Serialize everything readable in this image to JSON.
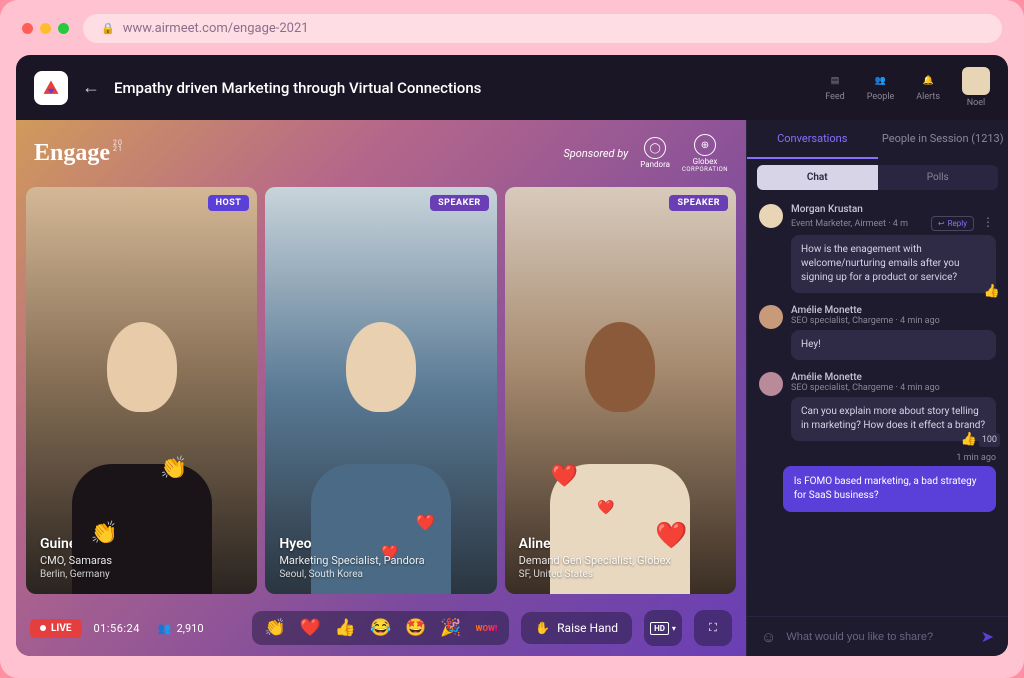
{
  "browser": {
    "url": "www.airmeet.com/engage-2021"
  },
  "header": {
    "title": "Empathy driven Marketing through Virtual Connections",
    "nav": [
      "Feed",
      "People",
      "Alerts"
    ],
    "user": "Noel"
  },
  "stage": {
    "brand": "Engage",
    "brand_year_top": "20",
    "brand_year_bottom": "21",
    "sponsored_by": "Sponsored by",
    "sponsors": [
      "Pandora",
      "Globex"
    ],
    "sponsor2_line2": "CORPORATION",
    "speakers": [
      {
        "role": "HOST",
        "name": "Guinevere Frazier",
        "title": "CMO, Samaras",
        "loc": "Berlin, Germany"
      },
      {
        "role": "SPEAKER",
        "name": "Hyeon Chin-Hae",
        "title": "Marketing Specialist, Pandora",
        "loc": "Seoul, South Korea"
      },
      {
        "role": "SPEAKER",
        "name": "Aline Richard",
        "title": "Demand Gen Specialist, Globex",
        "loc": "SF, United States"
      }
    ],
    "live": "LIVE",
    "time": "01:56:24",
    "viewers": "2,910",
    "raise_hand": "Raise Hand",
    "hd_label": "HD",
    "reactions_wow": "WOW!"
  },
  "sidebar": {
    "tabs": [
      "Conversations",
      "People in Session (1213)"
    ],
    "subtabs": [
      "Chat",
      "Polls"
    ],
    "messages": [
      {
        "name": "Morgan Krustan",
        "meta": "Event Marketer, Airmeet · 4 m",
        "text": "How is the enagement with welcome/nurturing emails after you signing up for a product or service?",
        "react": "👍",
        "reply": true
      },
      {
        "name": "Amélie Monette",
        "meta": "SEO specialist, Chargeme · 4 min ago",
        "text": "Hey!"
      },
      {
        "name": "Amélie Monette",
        "meta": "SEO specialist, Chargeme · 4 min ago",
        "text": "Can you explain more about story telling in marketing? How does it effect a brand?",
        "react": "👍",
        "count": "100"
      }
    ],
    "own": {
      "time": "1 min ago",
      "text": "Is FOMO based marketing, a bad strategy for SaaS business?"
    },
    "reply_label": "Reply",
    "input_placeholder": "What would you like to share?"
  }
}
